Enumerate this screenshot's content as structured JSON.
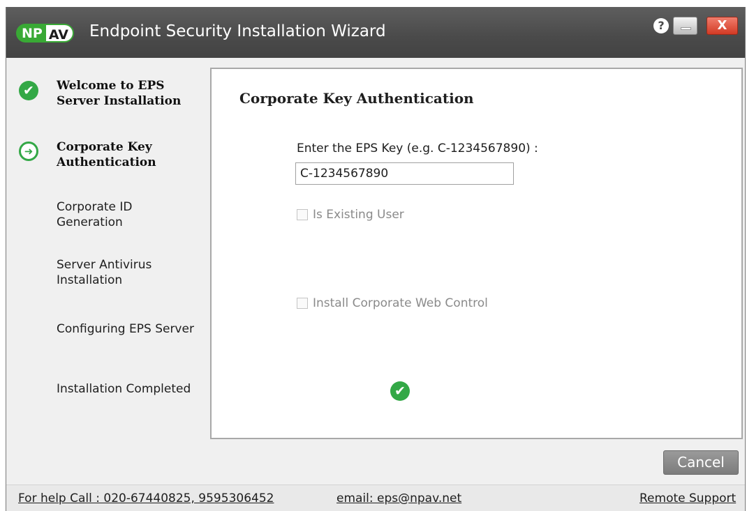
{
  "window": {
    "title": "Endpoint Security Installation Wizard",
    "logo": {
      "np": "NP",
      "av": "AV"
    },
    "help_glyph": "?",
    "close_glyph": "X",
    "colors": {
      "accent_green": "#33a846",
      "titlebar": "#4a4a4a",
      "close_red": "#d23a24"
    }
  },
  "sidebar": {
    "steps": [
      {
        "label_line1": "Welcome to EPS",
        "label_line2": "Server Installation",
        "status": "done",
        "icon": "check-icon"
      },
      {
        "label_line1": "Corporate Key",
        "label_line2": "Authentication",
        "status": "current",
        "icon": "arrow-right-icon"
      },
      {
        "label_line1": "Corporate ID",
        "label_line2": "Generation",
        "status": "pending"
      },
      {
        "label_line1": "Server Antivirus",
        "label_line2": "Installation",
        "status": "pending"
      },
      {
        "label_line1": "Configuring EPS Server",
        "label_line2": "",
        "status": "pending"
      },
      {
        "label_line1": "Installation Completed",
        "label_line2": "",
        "status": "pending"
      }
    ],
    "check_glyph": "✔",
    "arrow_glyph": "➜"
  },
  "main": {
    "heading": "Corporate Key Authentication",
    "key_label": "Enter the EPS Key (e.g. C-1234567890) :",
    "key_value": "C-1234567890",
    "existing_user_label": "Is Existing User",
    "existing_user_checked": false,
    "web_control_label": "Install Corporate Web Control",
    "web_control_checked": false,
    "valid_glyph": "✔"
  },
  "buttons": {
    "cancel": "Cancel"
  },
  "footer": {
    "help_call": "For help Call : 020-67440825, 9595306452",
    "email": "email: eps@npav.net",
    "remote_support": "Remote Support"
  }
}
